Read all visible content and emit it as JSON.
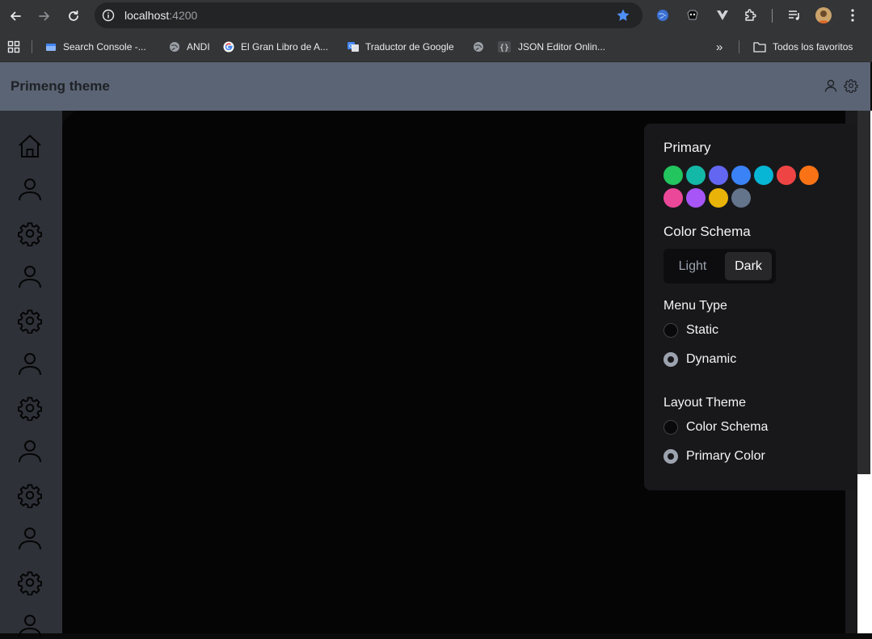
{
  "browser": {
    "url_host": "localhost",
    "url_port": ":4200"
  },
  "bookmarks": [
    {
      "label": "Search Console -..."
    },
    {
      "label": "ANDI"
    },
    {
      "label": "El Gran Libro de A..."
    },
    {
      "label": "Traductor de Google"
    },
    {
      "label": "JSON Editor Onlin..."
    }
  ],
  "bookmarks_more": "»",
  "bookmarks_folder": "Todos los favoritos",
  "app": {
    "title": "Primeng theme"
  },
  "config": {
    "primary_title": "Primary",
    "primary_colors": [
      "#22c55e",
      "#14b8a6",
      "#6366f1",
      "#3b82f6",
      "#06b6d4",
      "#ef4444",
      "#f97316",
      "#ec4899",
      "#a855f7",
      "#eab308",
      "#64748b"
    ],
    "color_schema_title": "Color Schema",
    "color_schema_options": [
      "Light",
      "Dark"
    ],
    "color_schema_selected": "Dark",
    "menu_type_title": "Menu Type",
    "menu_type_options": [
      "Static",
      "Dynamic"
    ],
    "menu_type_selected": "Dynamic",
    "layout_theme_title": "Layout Theme",
    "layout_theme_options": [
      "Color Schema",
      "Primary Color"
    ],
    "layout_theme_selected": "Primary Color"
  },
  "sidebar_icons": [
    "home-icon",
    "user-icon",
    "gear-icon",
    "user-icon",
    "gear-icon",
    "user-icon",
    "gear-icon",
    "user-icon",
    "gear-icon",
    "user-icon",
    "gear-icon",
    "user-icon"
  ],
  "colors": {
    "header_bg": "#5b6474",
    "sidebar_bg": "#2e3138",
    "main_bg": "#050505",
    "panel_bg": "#18181b",
    "star": "#1a73e8"
  }
}
